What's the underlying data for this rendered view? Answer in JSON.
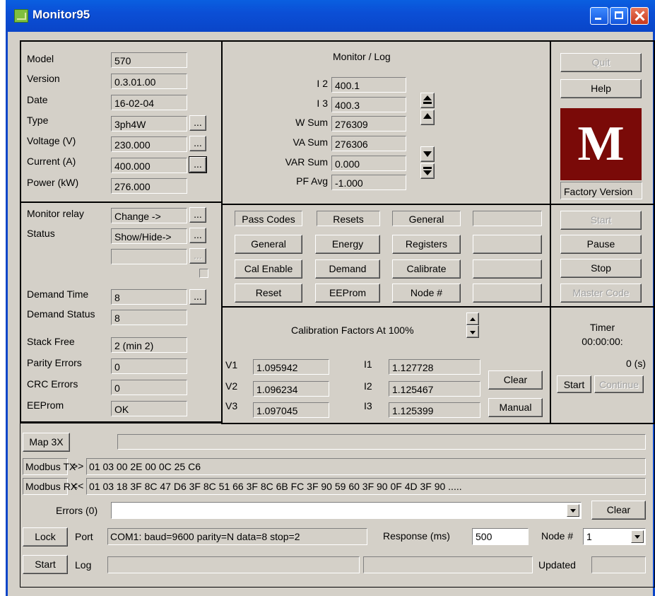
{
  "window": {
    "title": "Monitor95"
  },
  "device": {
    "rows": [
      {
        "label": "Model",
        "value": "570"
      },
      {
        "label": "Version",
        "value": "0.3.01.00"
      },
      {
        "label": "Date",
        "value": "16-02-04"
      },
      {
        "label": "Type",
        "value": "3ph4W"
      },
      {
        "label": "Voltage (V)",
        "value": "230.000"
      },
      {
        "label": "Current (A)",
        "value": "400.000"
      },
      {
        "label": "Power (kW)",
        "value": "276.000"
      }
    ],
    "more_label": "...",
    "monitor_relay": {
      "label": "Monitor relay",
      "value": "Change      ->"
    },
    "status": {
      "label": "Status",
      "value": "Show/Hide->"
    },
    "demand_time": {
      "label": "Demand Time",
      "value": "8"
    },
    "demand_status": {
      "label": "Demand Status",
      "value": "8"
    },
    "stack_free": {
      "label": "Stack Free",
      "value": "2  (min 2)"
    },
    "parity_errors": {
      "label": "Parity Errors",
      "value": "0"
    },
    "crc_errors": {
      "label": "CRC Errors",
      "value": "0"
    },
    "eeprom": {
      "label": "EEProm",
      "value": "OK"
    }
  },
  "monitor": {
    "title": "Monitor / Log",
    "rows": [
      {
        "label": "I 2",
        "value": "400.1"
      },
      {
        "label": "I 3",
        "value": "400.3"
      },
      {
        "label": "W Sum",
        "value": "276309"
      },
      {
        "label": "VA Sum",
        "value": "276306"
      },
      {
        "label": "VAR Sum",
        "value": "0.000"
      },
      {
        "label": "PF Avg",
        "value": "-1.000"
      }
    ]
  },
  "side": {
    "quit": "Quit",
    "help": "Help",
    "logo_letter": "M",
    "factory_version": "Factory Version"
  },
  "codes": {
    "headers": [
      "Pass Codes",
      "Resets",
      "General",
      ""
    ],
    "buttons": [
      "General",
      "Energy",
      "Registers",
      "",
      "Cal Enable",
      "Demand",
      "Calibrate",
      "",
      "Reset",
      "EEProm",
      "Node #",
      ""
    ]
  },
  "run": {
    "start": "Start",
    "pause": "Pause",
    "stop": "Stop",
    "master_code": "Master Code"
  },
  "calibration": {
    "title": "Calibration Factors At 100%",
    "v": [
      {
        "label": "V1",
        "value": "1.095942"
      },
      {
        "label": "V2",
        "value": "1.096234"
      },
      {
        "label": "V3",
        "value": "1.097045"
      }
    ],
    "i": [
      {
        "label": "I1",
        "value": "1.127728"
      },
      {
        "label": "I2",
        "value": "1.125467"
      },
      {
        "label": "I3",
        "value": "1.125399"
      }
    ],
    "clear": "Clear",
    "manual": "Manual"
  },
  "timer": {
    "label": "Timer",
    "time": "00:00:00:",
    "seconds": "0 (s)",
    "start": "Start",
    "continue": "Continue"
  },
  "bottom": {
    "map_button": "Map 3X",
    "tx_label": "Modbus TX",
    "tx_arrow": ">>",
    "tx_value": "01 03 00 2E 00 0C 25 C6",
    "rx_label": "Modbus RX",
    "rx_arrow": "<<",
    "rx_value": "01 03 18 3F 8C 47 D6 3F 8C 51 66 3F 8C 6B FC 3F 90 59 60 3F 90 0F 4D 3F 90 .....",
    "errors_label": "Errors (0)",
    "errors_value": "",
    "clear": "Clear",
    "lock": "Lock",
    "port_label": "Port",
    "port_value": "COM1: baud=9600 parity=N data=8 stop=2",
    "response_label": "Response  (ms)",
    "response_value": "500",
    "node_label": "Node #",
    "node_value": "1",
    "start": "Start",
    "log_label": "Log",
    "updated_label": "Updated"
  }
}
